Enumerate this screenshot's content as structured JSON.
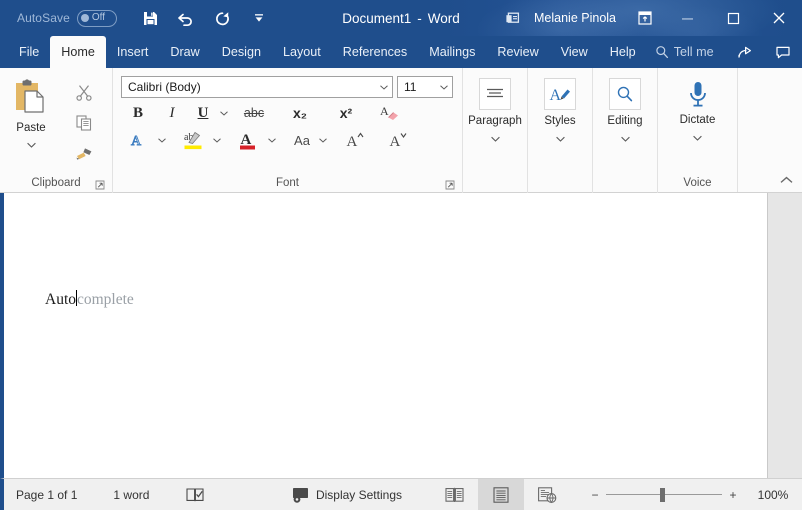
{
  "titlebar": {
    "autosave_label": "AutoSave",
    "autosave_state": "Off",
    "quick_access": [
      {
        "name": "save-button",
        "label": "Save"
      },
      {
        "name": "undo-button",
        "label": "Undo"
      },
      {
        "name": "redo-button",
        "label": "Redo"
      },
      {
        "name": "customize-quick-access-toolbar-button",
        "label": "Customize Quick Access Toolbar"
      }
    ],
    "document_name": "Document1",
    "separator": "-",
    "app_name": "Word",
    "account_name": "Melanie Pinola",
    "ribbon_display_options": "Ribbon Display Options",
    "minimize": "Minimize",
    "restore": "Restore Down",
    "close": "Close",
    "bg_color": "#1f4e8c"
  },
  "tabs": [
    {
      "label": "File",
      "active": false
    },
    {
      "label": "Home",
      "active": true
    },
    {
      "label": "Insert",
      "active": false
    },
    {
      "label": "Draw",
      "active": false
    },
    {
      "label": "Design",
      "active": false
    },
    {
      "label": "Layout",
      "active": false
    },
    {
      "label": "References",
      "active": false
    },
    {
      "label": "Mailings",
      "active": false
    },
    {
      "label": "Review",
      "active": false
    },
    {
      "label": "View",
      "active": false
    },
    {
      "label": "Help",
      "active": false
    }
  ],
  "tellme": {
    "label": "Tell me"
  },
  "tab_right_icons": [
    {
      "name": "share-icon",
      "label": "Share"
    },
    {
      "name": "comments-icon",
      "label": "Comments"
    }
  ],
  "ribbon": {
    "clipboard": {
      "group_label": "Clipboard",
      "paste_label": "Paste",
      "cut_label": "Cut",
      "copy_label": "Copy",
      "format_painter_label": "Format Painter",
      "dialog_launcher_label": "Clipboard dialog box launcher"
    },
    "font": {
      "group_label": "Font",
      "font_name": "Calibri (Body)",
      "font_size": "11",
      "bold": "B",
      "italic": "I",
      "underline": "U",
      "strikethrough": "abc",
      "subscript": "x₂",
      "superscript": "x²",
      "clear_formatting_label": "Clear All Formatting",
      "text_effects_label": "Text Effects and Typography",
      "highlight_label": "Text Highlight Color",
      "font_color_label": "Font Color",
      "change_case": "Aa",
      "grow_font_label": "Increase Font Size",
      "shrink_font_label": "Decrease Font Size",
      "dialog_launcher_label": "Font dialog box launcher"
    },
    "paragraph": {
      "label": "Paragraph"
    },
    "styles": {
      "label": "Styles"
    },
    "editing": {
      "label": "Editing"
    },
    "voice": {
      "group_label": "Voice",
      "dictate_label": "Dictate"
    },
    "collapse_label": "Collapse the Ribbon"
  },
  "document": {
    "typed_text": "Auto",
    "suggestion_text": "complete",
    "suggestion_color": "#9aa0a6"
  },
  "statusbar": {
    "page": "Page 1 of 1",
    "words": "1 word",
    "proofing_label": "Proofing errors check",
    "display_settings": "Display Settings",
    "views": [
      {
        "name": "read-mode-view-button",
        "label": "Read Mode",
        "selected": false
      },
      {
        "name": "print-layout-view-button",
        "label": "Print Layout",
        "selected": true
      },
      {
        "name": "web-layout-view-button",
        "label": "Web Layout",
        "selected": false
      }
    ],
    "zoom_out": "−",
    "zoom_in": "+",
    "zoom_level": "100%"
  }
}
